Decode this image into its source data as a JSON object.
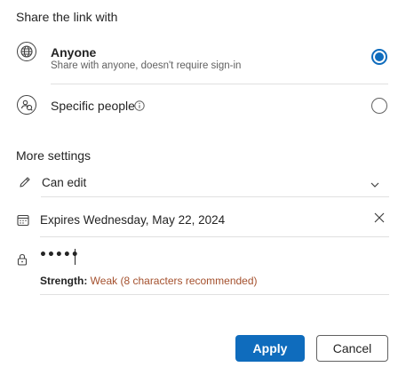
{
  "share": {
    "heading": "Share the link with",
    "options": [
      {
        "title": "Anyone",
        "subtitle": "Share with anyone, doesn't require sign-in",
        "selected": true
      },
      {
        "title": "Specific people",
        "subtitle": "",
        "selected": false
      }
    ]
  },
  "settings": {
    "heading": "More settings",
    "permission": "Can edit",
    "expiration": "Expires Wednesday, May 22, 2024",
    "password_value": "•••••",
    "strength_label": "Strength:",
    "strength_value": "Weak (8 characters recommended)"
  },
  "actions": {
    "apply": "Apply",
    "cancel": "Cancel"
  },
  "colors": {
    "accent": "#0f6cbd",
    "weak": "#a4502d"
  },
  "icons": [
    "globe-icon",
    "people-icon",
    "info-icon",
    "pencil-icon",
    "chevron-down-icon",
    "calendar-icon",
    "close-icon",
    "lock-icon"
  ]
}
